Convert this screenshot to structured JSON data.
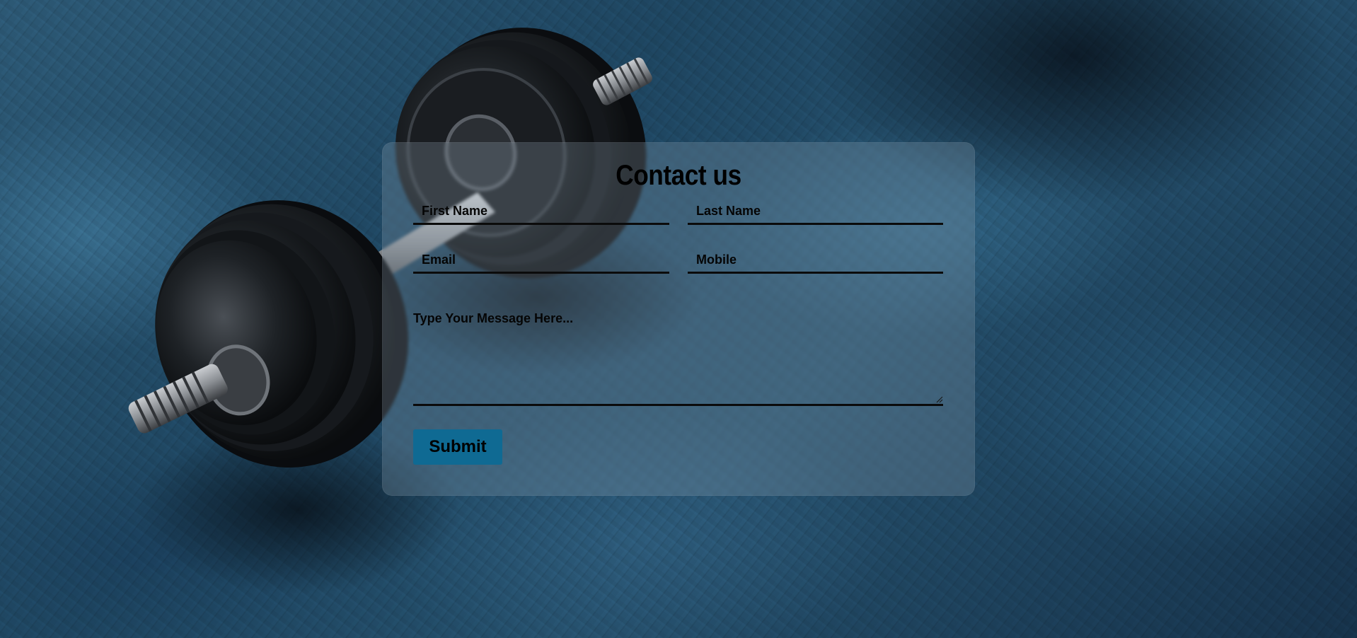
{
  "contact_form": {
    "title": "Contact us",
    "first_name_placeholder": "First Name",
    "last_name_placeholder": "Last Name",
    "email_placeholder": "Email",
    "mobile_placeholder": "Mobile",
    "message_placeholder": "Type Your Message Here...",
    "submit_label": "Submit"
  },
  "colors": {
    "background": "#1e4560",
    "card_overlay": "#96aab9",
    "underline": "#0b0b0b",
    "submit_button": "#0f6a93",
    "text": "#000000"
  },
  "icons": {
    "background_image": "dumbbell-photo",
    "textarea_corner": "resize-grip-icon"
  }
}
